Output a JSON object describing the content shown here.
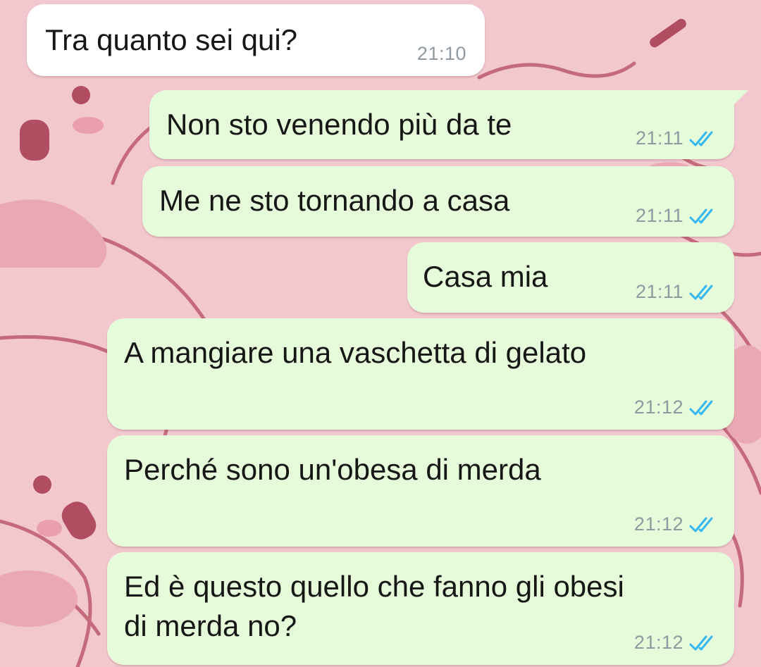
{
  "colors": {
    "wallpaper": "#f2c7ce",
    "incoming_bubble": "#ffffff",
    "outgoing_bubble": "#e6fbd9",
    "timestamp": "#8f9aa0",
    "read_ticks": "#34b7f1"
  },
  "messages": [
    {
      "direction": "incoming",
      "text": "Tra quanto sei qui?",
      "time": "21:10"
    },
    {
      "direction": "outgoing",
      "text": "Non sto venendo più da te",
      "time": "21:11",
      "status_icon": "double-check-read-icon"
    },
    {
      "direction": "outgoing",
      "text": "Me ne sto tornando a casa",
      "time": "21:11",
      "status_icon": "double-check-read-icon"
    },
    {
      "direction": "outgoing",
      "text": "Casa mia",
      "time": "21:11",
      "status_icon": "double-check-read-icon"
    },
    {
      "direction": "outgoing",
      "text": "A mangiare una vaschetta di gelato",
      "time": "21:12",
      "status_icon": "double-check-read-icon"
    },
    {
      "direction": "outgoing",
      "text": "Perché sono un'obesa di merda",
      "time": "21:12",
      "status_icon": "double-check-read-icon"
    },
    {
      "direction": "outgoing",
      "text_lines": [
        "Ed è questo quello che fanno gli obesi",
        "di merda no?"
      ],
      "time": "21:12",
      "status_icon": "double-check-read-icon"
    }
  ]
}
